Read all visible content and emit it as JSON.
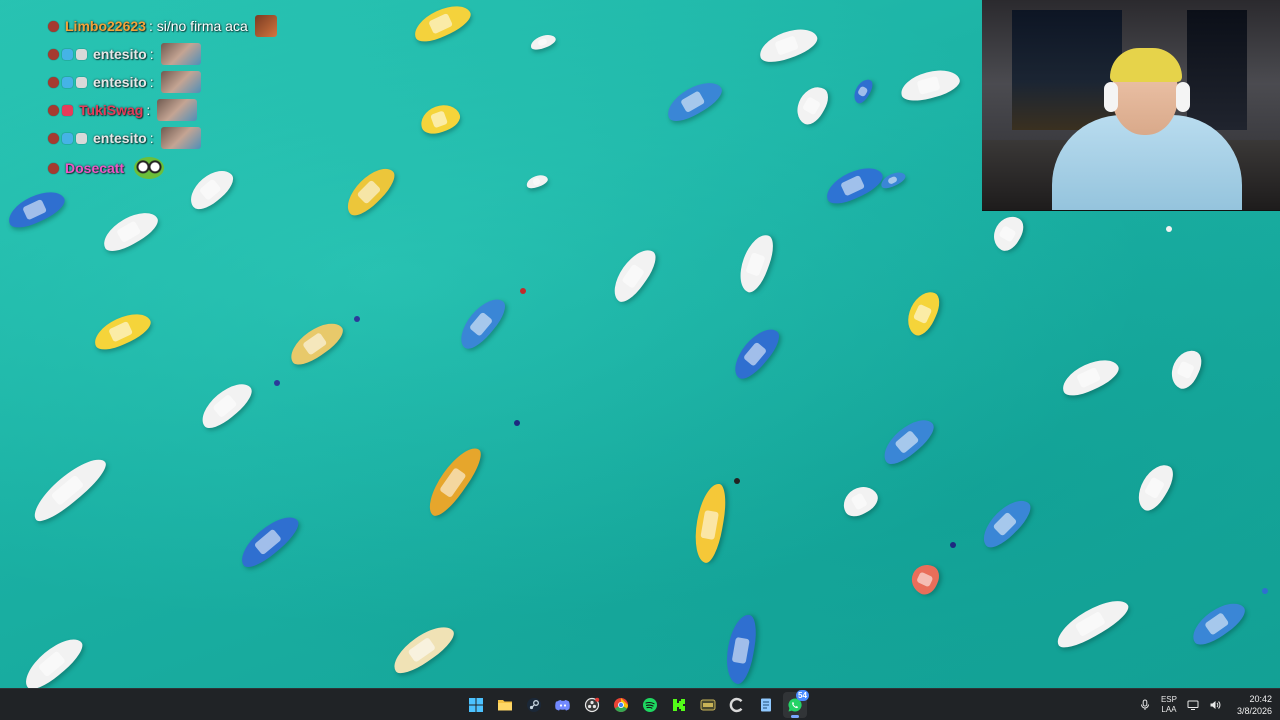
{
  "chat": {
    "messages": [
      {
        "username": "Limbo22623",
        "text": ": si/no firma aca",
        "color": "#f2a33a",
        "emote": "face-emote"
      },
      {
        "username": "entesito",
        "text": ":",
        "color": "#e8e8e8",
        "emote": "portrait-emote"
      },
      {
        "username": "entesito",
        "text": ":",
        "color": "#e8e8e8",
        "emote": "portrait-emote"
      },
      {
        "username": "TukiSwag",
        "text": ":",
        "color": "#e63c5a",
        "emote": "portrait-emote"
      },
      {
        "username": "entesito",
        "text": ":",
        "color": "#e8e8e8",
        "emote": "portrait-emote"
      },
      {
        "username": "Dosecatt",
        "text": "",
        "color": "#ee55c5",
        "emote": "frog-emote"
      }
    ]
  },
  "taskbar": {
    "apps": [
      {
        "name": "start-button",
        "icon": "windows-logo-icon",
        "color": "#4cc2ff"
      },
      {
        "name": "file-explorer-button",
        "icon": "folder-icon",
        "color": "#f5c243"
      },
      {
        "name": "steam-button",
        "icon": "steam-icon",
        "color": "#c7d5e0"
      },
      {
        "name": "discord-button",
        "icon": "discord-icon",
        "color": "#7289ff"
      },
      {
        "name": "obs-button",
        "icon": "record-icon",
        "color": "#e6e6e6"
      },
      {
        "name": "chrome-button",
        "icon": "chrome-icon",
        "color": "#34a853"
      },
      {
        "name": "spotify-button",
        "icon": "spotify-icon",
        "color": "#1ed760"
      },
      {
        "name": "kick-button",
        "icon": "kick-icon",
        "color": "#53fc18"
      },
      {
        "name": "game-launcher-button",
        "icon": "controller-icon",
        "color": "#c9b458"
      },
      {
        "name": "ccleaner-button",
        "icon": "c-logo-icon",
        "color": "#d9d9d9"
      },
      {
        "name": "notepad-button",
        "icon": "notepad-icon",
        "color": "#8fc8ff"
      },
      {
        "name": "whatsapp-button",
        "icon": "whatsapp-icon",
        "color": "#25d366",
        "badge": "54"
      }
    ],
    "tray": {
      "lang_primary": "ESP",
      "lang_secondary": "LAA",
      "time": "20:42",
      "date": "3/8/2026"
    }
  }
}
